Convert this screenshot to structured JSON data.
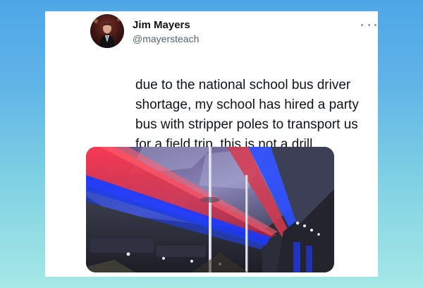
{
  "tweet": {
    "author_name": "Jim Mayers",
    "author_handle": "@mayersteach",
    "text_lines": [
      "due to the national school bus driver",
      "shortage, my school has hired a party",
      "bus with stripper poles to transport us",
      "for a field trip. this is not a drill."
    ],
    "more_icon": "more-horizontal-icon",
    "media_subject": "party bus interior with red and blue LED ceiling lights and stripper poles"
  },
  "colors": {
    "background_top": "#4ea6e6",
    "background_bottom": "#a6e8e6",
    "card": "#ffffff",
    "text": "#0f1419",
    "secondary_text": "#536471"
  }
}
